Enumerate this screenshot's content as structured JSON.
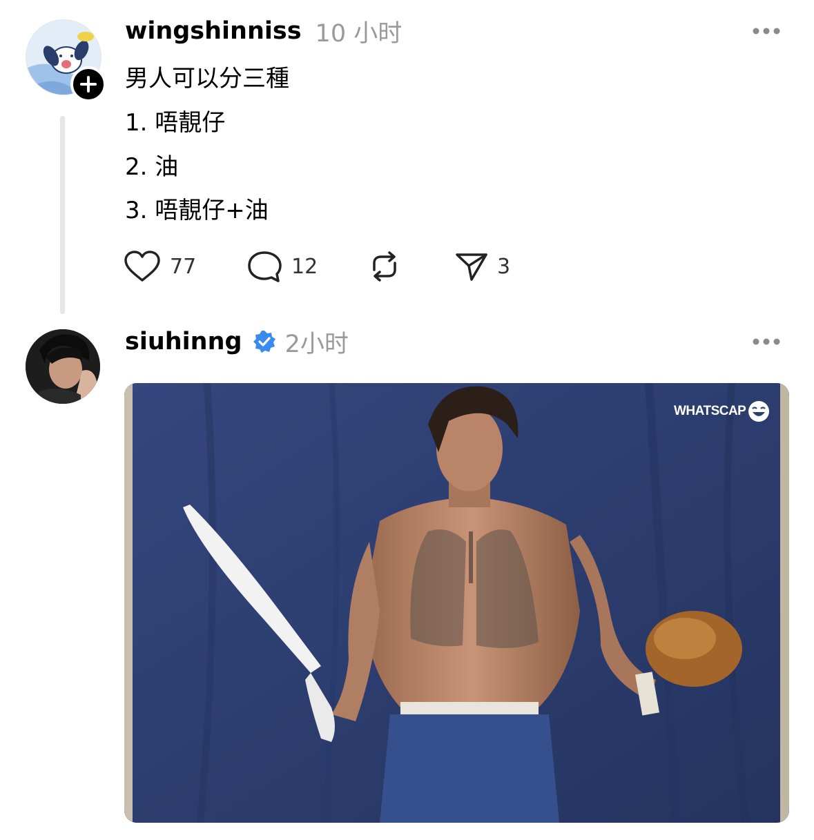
{
  "post": {
    "username": "wingshinniss",
    "time": "10 小时",
    "more_icon": "more-horizontal-icon",
    "lines": [
      "男人可以分三種",
      "1. 唔靚仔",
      "2. 油",
      "3. 唔靚仔+油"
    ],
    "actions": {
      "like": {
        "icon": "heart-icon",
        "count": "77"
      },
      "comment": {
        "icon": "comment-icon",
        "count": "12"
      },
      "repost": {
        "icon": "repost-icon",
        "count": ""
      },
      "share": {
        "icon": "send-icon",
        "count": "3"
      }
    },
    "follow_icon": "plus-icon"
  },
  "reply": {
    "username": "siuhinng",
    "verified_icon": "verified-badge-icon",
    "time": "2小时",
    "more_icon": "more-horizontal-icon",
    "image_watermark": "WHATSCAP"
  },
  "colors": {
    "verified": "#3b8af0",
    "secondary_text": "#9a9a9a",
    "backdrop": "#2e3f74"
  }
}
